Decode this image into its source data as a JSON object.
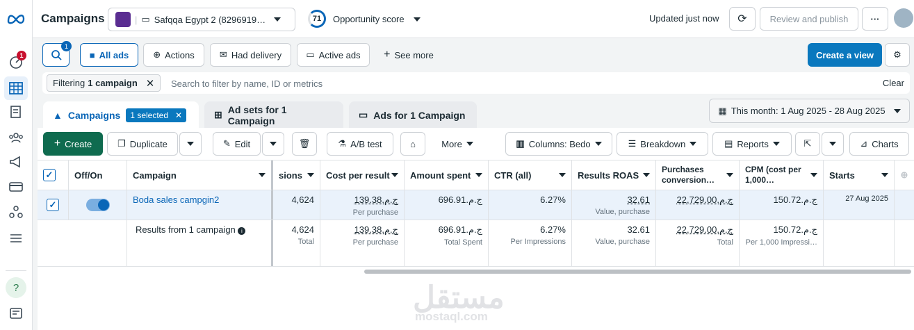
{
  "header": {
    "title": "Campaigns",
    "account_name": "Safqqa Egypt 2 (8296919…",
    "opportunity_score": "71",
    "opportunity_label": "Opportunity score",
    "updated": "Updated just now",
    "review_publish": "Review and publish",
    "more": "···"
  },
  "rail": {
    "notification_count": "1"
  },
  "filter_bar": {
    "search_badge": "1",
    "buttons": [
      "All ads",
      "Actions",
      "Had delivery",
      "Active ads",
      "See more"
    ],
    "create_view": "Create a view"
  },
  "search": {
    "chip_prefix": "Filtering",
    "chip_bold": "1 campaign",
    "placeholder": "Search to filter by name, ID or metrics",
    "clear": "Clear"
  },
  "tabs": {
    "campaigns": "Campaigns",
    "selected": "1 selected",
    "adsets": "Ad sets for 1 Campaign",
    "ads": "Ads for 1 Campaign"
  },
  "date_range": "This month: 1 Aug 2025 - 28 Aug 2025",
  "toolbar": {
    "create": "Create",
    "duplicate": "Duplicate",
    "edit": "Edit",
    "ab_test": "A/B test",
    "more": "More",
    "columns": "Columns: Bedo",
    "breakdown": "Breakdown",
    "reports": "Reports",
    "charts": "Charts"
  },
  "table": {
    "headers": {
      "off_on": "Off/On",
      "campaign": "Campaign",
      "results_partial": "sions",
      "cost_per_result": "Cost per result",
      "amount_spent": "Amount spent",
      "ctr": "CTR (all)",
      "roas": "Results ROAS",
      "purchases_1": "Purchases",
      "purchases_2": "conversion…",
      "cpm_1": "CPM (cost per",
      "cpm_2": "1,000…",
      "starts": "Starts"
    },
    "row": {
      "name": "Boda sales campgin2",
      "results": "4,624",
      "cost": "139.38.ج.م",
      "cost_sub": "Per purchase",
      "spent": "696.91.ج.م",
      "ctr": "6.27%",
      "roas": "32.61",
      "roas_sub": "Value, purchase",
      "purchases": "22,729.00.ج.م",
      "cpm": "150.72.ج.م",
      "starts": "27 Aug 2025"
    },
    "summary": {
      "label": "Results from 1 campaign",
      "results": "4,624",
      "results_sub": "Total",
      "cost": "139.38.ج.م",
      "cost_sub": "Per purchase",
      "spent": "696.91.ج.م",
      "spent_sub": "Total Spent",
      "ctr": "6.27%",
      "ctr_sub": "Per Impressions",
      "roas": "32.61",
      "roas_sub": "Value, purchase",
      "purchases": "22,729.00.ج.م",
      "purchases_sub": "Total",
      "cpm": "150.72.ج.م",
      "cpm_sub": "Per 1,000 Impressi…"
    }
  },
  "watermark": {
    "arabic": "مستقل",
    "latin": "mostaql.com"
  },
  "colors": {
    "brand_blue": "#0a78be",
    "create_green": "#0f6b4f",
    "selected_row": "#eaf2fb",
    "alert_red": "#c8102e"
  }
}
